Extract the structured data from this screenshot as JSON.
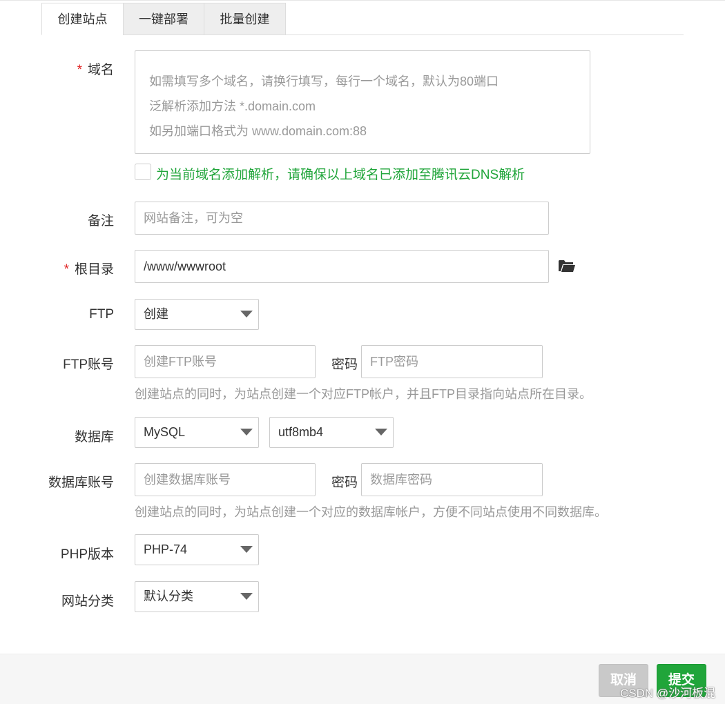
{
  "tabs": [
    "创建站点",
    "一键部署",
    "批量创建"
  ],
  "domain": {
    "label": "域名",
    "required_mark": "*",
    "placeholder_lines": [
      "如需填写多个域名，请换行填写，每行一个域名，默认为80端口",
      "泛解析添加方法 *.domain.com",
      "如另加端口格式为 www.domain.com:88"
    ],
    "dns_checkbox_label": "为当前域名添加解析，请确保以上域名已添加至腾讯云DNS解析"
  },
  "remark": {
    "label": "备注",
    "placeholder": "网站备注，可为空"
  },
  "root": {
    "label": "根目录",
    "required_mark": "*",
    "value": "/www/wwwroot"
  },
  "ftp": {
    "label": "FTP",
    "selected": "创建"
  },
  "ftp_account": {
    "label": "FTP账号",
    "account_placeholder": "创建FTP账号",
    "password_label": "密码",
    "password_placeholder": "FTP密码",
    "hint": "创建站点的同时，为站点创建一个对应FTP帐户，并且FTP目录指向站点所在目录。"
  },
  "database": {
    "label": "数据库",
    "type_selected": "MySQL",
    "charset_selected": "utf8mb4"
  },
  "db_account": {
    "label": "数据库账号",
    "account_placeholder": "创建数据库账号",
    "password_label": "密码",
    "password_placeholder": "数据库密码",
    "hint": "创建站点的同时，为站点创建一个对应的数据库帐户，方便不同站点使用不同数据库。"
  },
  "php": {
    "label": "PHP版本",
    "selected": "PHP-74"
  },
  "category": {
    "label": "网站分类",
    "selected": "默认分类"
  },
  "footer": {
    "cancel": "取消",
    "submit": "提交"
  },
  "watermark": "CSDN @沙河板混",
  "colors": {
    "accent": "#20a53a",
    "required": "#e02020",
    "placeholder": "#999999"
  }
}
